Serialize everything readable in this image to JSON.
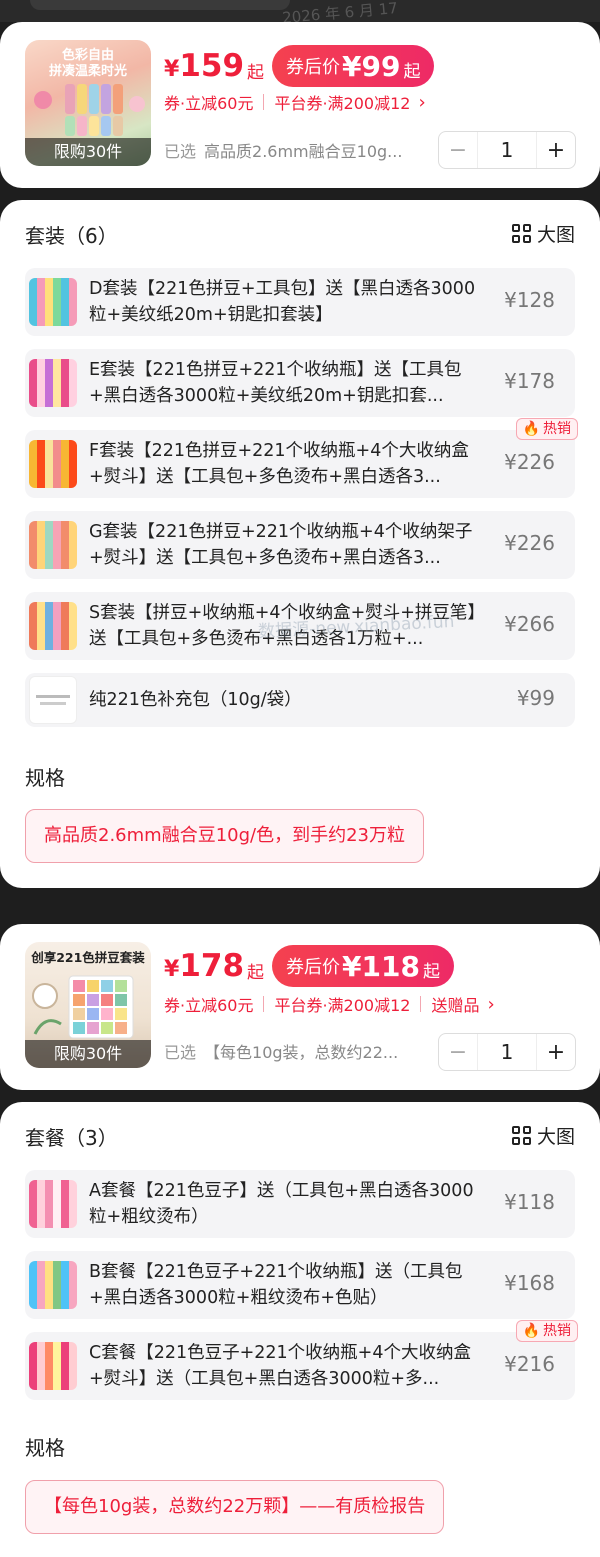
{
  "top_partial_text": "2026 年 6 月 17",
  "product1": {
    "thumb_text": [
      "色彩自由",
      "拼凑温柔时光"
    ],
    "limit": "限购30件",
    "price_yen": "¥",
    "price": "159",
    "price_suffix": "起",
    "after_label": "券后价",
    "after_price": "¥99",
    "after_suffix": "起",
    "coupons": [
      "券·立减60元",
      "平台券·满200减12"
    ],
    "selected_label": "已选",
    "selected_value": "高品质2.6mm融合豆10g...",
    "quantity": "1",
    "minus": "−",
    "plus": "+",
    "section_title": "套装（6）",
    "bigpic": "大图",
    "options": [
      {
        "text": "D套装【221色拼豆+工具包】送【黑白透各3000粒+美纹纸20m+钥匙扣套装】",
        "price": "¥128",
        "hot": false
      },
      {
        "text": "E套装【221色拼豆+221个收纳瓶】送【工具包+黑白透各3000粒+美纹纸20m+钥匙扣套...",
        "price": "¥178",
        "hot": false
      },
      {
        "text": "F套装【221色拼豆+221个收纳瓶+4个大收纳盒+熨斗】送【工具包+多色烫布+黑白透各3...",
        "price": "¥226",
        "hot": true
      },
      {
        "text": "G套装【221色拼豆+221个收纳瓶+4个收纳架子+熨斗】送【工具包+多色烫布+黑白透各3...",
        "price": "¥226",
        "hot": false
      },
      {
        "text": "S套装【拼豆+收纳瓶+4个收纳盒+熨斗+拼豆笔】送【工具包+多色烫布+黑白透各1万粒+...",
        "price": "¥266",
        "hot": false
      },
      {
        "text": "纯221色补充包（10g/袋）",
        "price": "¥99",
        "hot": false
      }
    ],
    "spec_title": "规格",
    "spec_value": "高品质2.6mm融合豆10g/色，到手约23万粒"
  },
  "product2": {
    "thumb_text": [
      "创享221色拼豆套装"
    ],
    "limit": "限购30件",
    "price_yen": "¥",
    "price": "178",
    "price_suffix": "起",
    "after_label": "券后价",
    "after_price": "¥118",
    "after_suffix": "起",
    "coupons": [
      "券·立减60元",
      "平台券·满200减12",
      "送赠品"
    ],
    "selected_label": "已选",
    "selected_value": "【每色10g装，总数约22...",
    "quantity": "1",
    "minus": "−",
    "plus": "+",
    "section_title": "套餐（3）",
    "bigpic": "大图",
    "options": [
      {
        "text": "A套餐【221色豆子】送（工具包+黑白透各3000粒+粗纹烫布）",
        "price": "¥118",
        "hot": false
      },
      {
        "text": "B套餐【221色豆子+221个收纳瓶】送（工具包+黑白透各3000粒+粗纹烫布+色贴）",
        "price": "¥168",
        "hot": false
      },
      {
        "text": "C套餐【221色豆子+221个收纳瓶+4个大收纳盒+熨斗】送（工具包+黑白透各3000粒+多...",
        "price": "¥216",
        "hot": true
      }
    ],
    "spec_title": "规格",
    "spec_value": "【每色10g装，总数约22万颗】——有质检报告"
  },
  "hot_label": "热销",
  "watermark": "数据源-new.xianbao.fun",
  "colors": {
    "accent": "#ee1f3a",
    "pill_start": "#f5414f",
    "pill_end": "#ee2a66",
    "option_bg": "#f4f4f6"
  }
}
